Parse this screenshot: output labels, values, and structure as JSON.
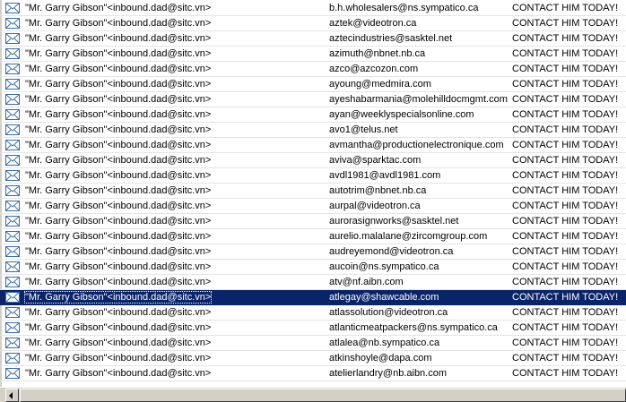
{
  "messages": [
    {
      "from": "\"Mr. Garry Gibson\"<inbound.dad@sitc.vn>",
      "to": "b.h.wholesalers@ns.sympatico.ca",
      "subject": "CONTACT HIM TODAY!"
    },
    {
      "from": "\"Mr. Garry Gibson\"<inbound.dad@sitc.vn>",
      "to": "aztek@videotron.ca",
      "subject": "CONTACT HIM TODAY!"
    },
    {
      "from": "\"Mr. Garry Gibson\"<inbound.dad@sitc.vn>",
      "to": "aztecindustries@sasktel.net",
      "subject": "CONTACT HIM TODAY!"
    },
    {
      "from": "\"Mr. Garry Gibson\"<inbound.dad@sitc.vn>",
      "to": "azimuth@nbnet.nb.ca",
      "subject": "CONTACT HIM TODAY!"
    },
    {
      "from": "\"Mr. Garry Gibson\"<inbound.dad@sitc.vn>",
      "to": "azco@azcozon.com",
      "subject": "CONTACT HIM TODAY!"
    },
    {
      "from": "\"Mr. Garry Gibson\"<inbound.dad@sitc.vn>",
      "to": "ayoung@medmira.com",
      "subject": "CONTACT HIM TODAY!"
    },
    {
      "from": "\"Mr. Garry Gibson\"<inbound.dad@sitc.vn>",
      "to": "ayeshabarmania@molehilldocmgmt.com",
      "subject": "CONTACT HIM TODAY!"
    },
    {
      "from": "\"Mr. Garry Gibson\"<inbound.dad@sitc.vn>",
      "to": "ayan@weeklyspecialsonline.com",
      "subject": "CONTACT HIM TODAY!"
    },
    {
      "from": "\"Mr. Garry Gibson\"<inbound.dad@sitc.vn>",
      "to": "avo1@telus.net",
      "subject": "CONTACT HIM TODAY!"
    },
    {
      "from": "\"Mr. Garry Gibson\"<inbound.dad@sitc.vn>",
      "to": "avmantha@productionelectronique.com",
      "subject": "CONTACT HIM TODAY!"
    },
    {
      "from": "\"Mr. Garry Gibson\"<inbound.dad@sitc.vn>",
      "to": "aviva@sparktac.com",
      "subject": "CONTACT HIM TODAY!"
    },
    {
      "from": "\"Mr. Garry Gibson\"<inbound.dad@sitc.vn>",
      "to": "avdl1981@avdl1981.com",
      "subject": "CONTACT HIM TODAY!"
    },
    {
      "from": "\"Mr. Garry Gibson\"<inbound.dad@sitc.vn>",
      "to": "autotrim@nbnet.nb.ca",
      "subject": "CONTACT HIM TODAY!"
    },
    {
      "from": "\"Mr. Garry Gibson\"<inbound.dad@sitc.vn>",
      "to": "aurpal@videotron.ca",
      "subject": "CONTACT HIM TODAY!"
    },
    {
      "from": "\"Mr. Garry Gibson\"<inbound.dad@sitc.vn>",
      "to": "aurorasignworks@sasktel.net",
      "subject": "CONTACT HIM TODAY!"
    },
    {
      "from": "\"Mr. Garry Gibson\"<inbound.dad@sitc.vn>",
      "to": "aurelio.malalane@zircomgroup.com",
      "subject": "CONTACT HIM TODAY!"
    },
    {
      "from": "\"Mr. Garry Gibson\"<inbound.dad@sitc.vn>",
      "to": "audreyemond@videotron.ca",
      "subject": "CONTACT HIM TODAY!"
    },
    {
      "from": "\"Mr. Garry Gibson\"<inbound.dad@sitc.vn>",
      "to": "aucoin@ns.sympatico.ca",
      "subject": "CONTACT HIM TODAY!"
    },
    {
      "from": "\"Mr. Garry Gibson\"<inbound.dad@sitc.vn>",
      "to": "atv@nf.aibn.com",
      "subject": "CONTACT HIM TODAY!"
    },
    {
      "from": "\"Mr. Garry Gibson\"<inbound.dad@sitc.vn>",
      "to": "atlegay@shawcable.com",
      "subject": "CONTACT HIM TODAY!",
      "selected": true
    },
    {
      "from": "\"Mr. Garry Gibson\"<inbound.dad@sitc.vn>",
      "to": "atlassolution@videotron.ca",
      "subject": "CONTACT HIM TODAY!"
    },
    {
      "from": "\"Mr. Garry Gibson\"<inbound.dad@sitc.vn>",
      "to": "atlanticmeatpackers@ns.sympatico.ca",
      "subject": "CONTACT HIM TODAY!"
    },
    {
      "from": "\"Mr. Garry Gibson\"<inbound.dad@sitc.vn>",
      "to": "atlalea@nb.sympatico.ca",
      "subject": "CONTACT HIM TODAY!"
    },
    {
      "from": "\"Mr. Garry Gibson\"<inbound.dad@sitc.vn>",
      "to": "atkinshoyle@dapa.com",
      "subject": "CONTACT HIM TODAY!"
    },
    {
      "from": "\"Mr. Garry Gibson\"<inbound.dad@sitc.vn>",
      "to": "atelierlandry@nb.aibn.com",
      "subject": "CONTACT HIM TODAY!"
    }
  ],
  "icon": "envelope-icon",
  "colors": {
    "selected_bg": "#0a246a",
    "icon_blue": "#3a6ea5"
  }
}
